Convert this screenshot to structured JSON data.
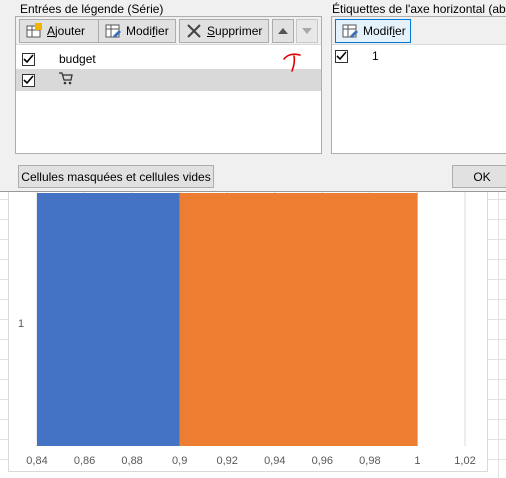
{
  "dialog": {
    "legend_group_label": "Entrées de légende (Série)",
    "axis_group_label": "Étiquettes de l'axe horizontal (abs",
    "toolbar": {
      "add_label": "Ajouter",
      "add_mnemonic": "A",
      "edit_label": "Modifier",
      "edit_mnemonic": "i",
      "delete_label": "Supprimer",
      "delete_mnemonic": "S"
    },
    "series": [
      {
        "label": "budget",
        "checked": true,
        "selected": false
      },
      {
        "label": "",
        "icon": "cart-icon",
        "checked": true,
        "selected": true
      }
    ],
    "axis_edit_label": "Modifier",
    "axis_labels": [
      {
        "label": "1",
        "checked": true
      }
    ],
    "hidden_cells_button": "Cellules masquées et cellules vides",
    "ok_button": "OK",
    "annotation_color": "#e00000"
  },
  "chart_data": {
    "type": "bar",
    "orientation": "horizontal",
    "stacked": true,
    "categories": [
      "1"
    ],
    "series": [
      {
        "name": "budget",
        "color": "#4472c4",
        "start": 0.84,
        "end": 0.9
      },
      {
        "name": "",
        "color": "#ed7d31",
        "start": 0.9,
        "end": 1.0
      }
    ],
    "xlim": [
      0.84,
      1.02
    ],
    "x_ticks": [
      "0,84",
      "0,86",
      "0,88",
      "0,9",
      "0,92",
      "0,94",
      "0,96",
      "0,98",
      "1",
      "1,02"
    ],
    "gridlines": true
  }
}
